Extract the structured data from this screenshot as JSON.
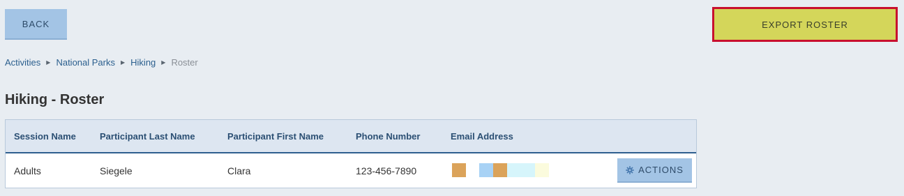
{
  "toolbar": {
    "back_label": "BACK",
    "export_label": "EXPORT ROSTER"
  },
  "breadcrumb": {
    "items": [
      "Activities",
      "National Parks",
      "Hiking"
    ],
    "current": "Roster"
  },
  "page": {
    "title": "Hiking - Roster"
  },
  "table": {
    "columns": [
      "Session Name",
      "Participant Last Name",
      "Participant First Name",
      "Phone Number",
      "Email Address"
    ],
    "rows": [
      {
        "session": "Adults",
        "last_name": "Siegele",
        "first_name": "Clara",
        "phone": "123-456-7890",
        "actions_label": "ACTIONS"
      }
    ]
  },
  "colors": {
    "background": "#e8edf2",
    "primary_button": "#a3c4e5",
    "export_button": "#d4d65a",
    "export_border": "#c8102e",
    "header_text": "#2b4f73"
  },
  "icons": {
    "actions": "gear-icon",
    "separator": "triangle-right-icon"
  }
}
